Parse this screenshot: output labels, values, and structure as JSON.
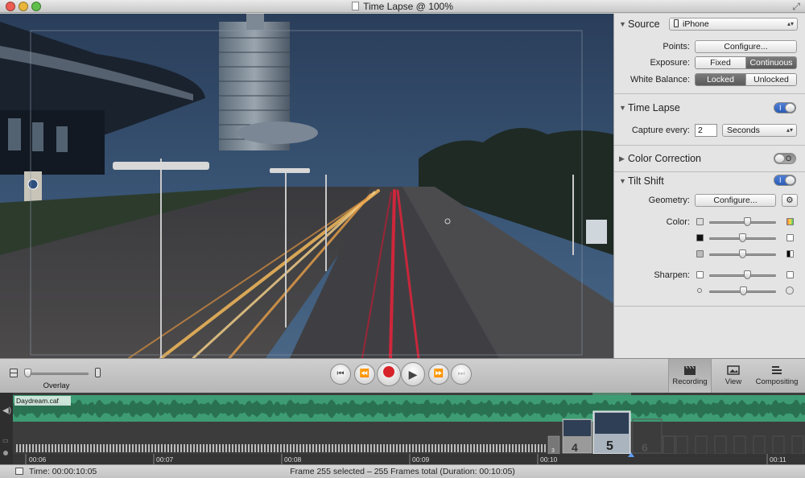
{
  "window": {
    "title": "Time Lapse @ 100%",
    "colors": {
      "close": "#ec5c53",
      "minimize": "#e8b53b",
      "zoom": "#5fbf4a",
      "accent": "#3f6fd0",
      "audio_track": "#3d9c73"
    }
  },
  "inspector": {
    "source": {
      "title": "Source",
      "device_value": "iPhone",
      "points_label": "Points:",
      "points_button": "Configure...",
      "exposure_label": "Exposure:",
      "exposure_options": [
        "Fixed",
        "Continuous"
      ],
      "exposure_selected": "Continuous",
      "white_balance_label": "White Balance:",
      "white_balance_options": [
        "Locked",
        "Unlocked"
      ],
      "white_balance_selected": "Locked"
    },
    "time_lapse": {
      "title": "Time Lapse",
      "enabled": true,
      "toggle_text": "I",
      "capture_label": "Capture every:",
      "capture_value": "2",
      "capture_unit": "Seconds"
    },
    "color_correction": {
      "title": "Color Correction",
      "enabled": false,
      "toggle_text": "O"
    },
    "tilt_shift": {
      "title": "Tilt Shift",
      "enabled": true,
      "toggle_text": "I",
      "geometry_label": "Geometry:",
      "geometry_button": "Configure...",
      "color_label": "Color:",
      "color_sliders": [
        0.58,
        0.5,
        0.5
      ],
      "sharpen_label": "Sharpen:",
      "sharpen_sliders": [
        0.58,
        0.52
      ]
    }
  },
  "controls": {
    "overlay_label": "Overlay",
    "overlay_value": 0.0,
    "transport": [
      {
        "name": "go-to-start",
        "enabled": true
      },
      {
        "name": "step-backward",
        "enabled": true
      },
      {
        "name": "record",
        "enabled": true
      },
      {
        "name": "play",
        "enabled": true
      },
      {
        "name": "step-forward",
        "enabled": false
      },
      {
        "name": "go-to-end",
        "enabled": false
      }
    ],
    "modes": [
      {
        "label": "Recording",
        "icon": "clapperboard-icon",
        "active": true
      },
      {
        "label": "View",
        "icon": "photo-icon",
        "active": false
      },
      {
        "label": "Compositing",
        "icon": "layers-icon",
        "active": false
      }
    ]
  },
  "timeline": {
    "audio_clip": "Daydream.caf",
    "tick_labels": [
      "00:06",
      "00:07",
      "00:08",
      "00:09",
      "00:10",
      "00:11"
    ],
    "frames": [
      "3",
      "4",
      "5",
      "6"
    ],
    "selected_frame": "5"
  },
  "status": {
    "time": "Time: 00:00:10:05",
    "message": "Frame 255 selected – 255 Frames total (Duration: 00:10:05)"
  }
}
